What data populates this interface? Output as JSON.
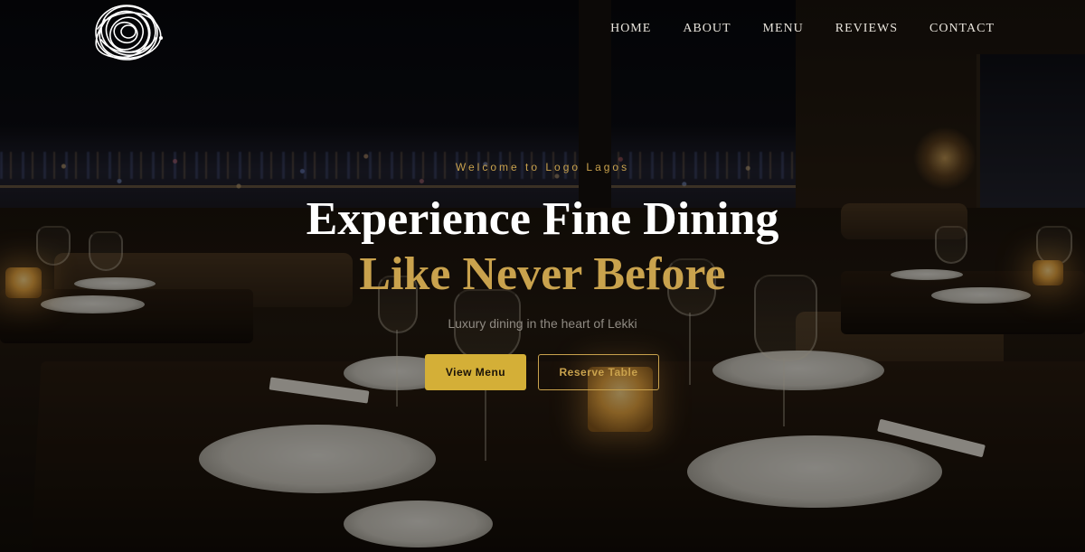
{
  "colors": {
    "accent_gold": "#c9a24d",
    "button_gold": "#d4af37",
    "heading_white": "#ffffff",
    "nav_text": "#e8e4dc"
  },
  "header": {
    "logo_icon": "scribble-circle-logo",
    "nav": [
      {
        "label": "HOME"
      },
      {
        "label": "ABOUT"
      },
      {
        "label": "MENU"
      },
      {
        "label": "REVIEWS"
      },
      {
        "label": "CONTACT"
      }
    ]
  },
  "hero": {
    "eyebrow": "Welcome to Logo Lagos",
    "title_line1": "Experience Fine Dining",
    "title_line2": "Like Never Before",
    "subtitle": "Luxury dining in the heart of Lekki",
    "primary_button": "View Menu",
    "secondary_button": "Reserve Table"
  }
}
